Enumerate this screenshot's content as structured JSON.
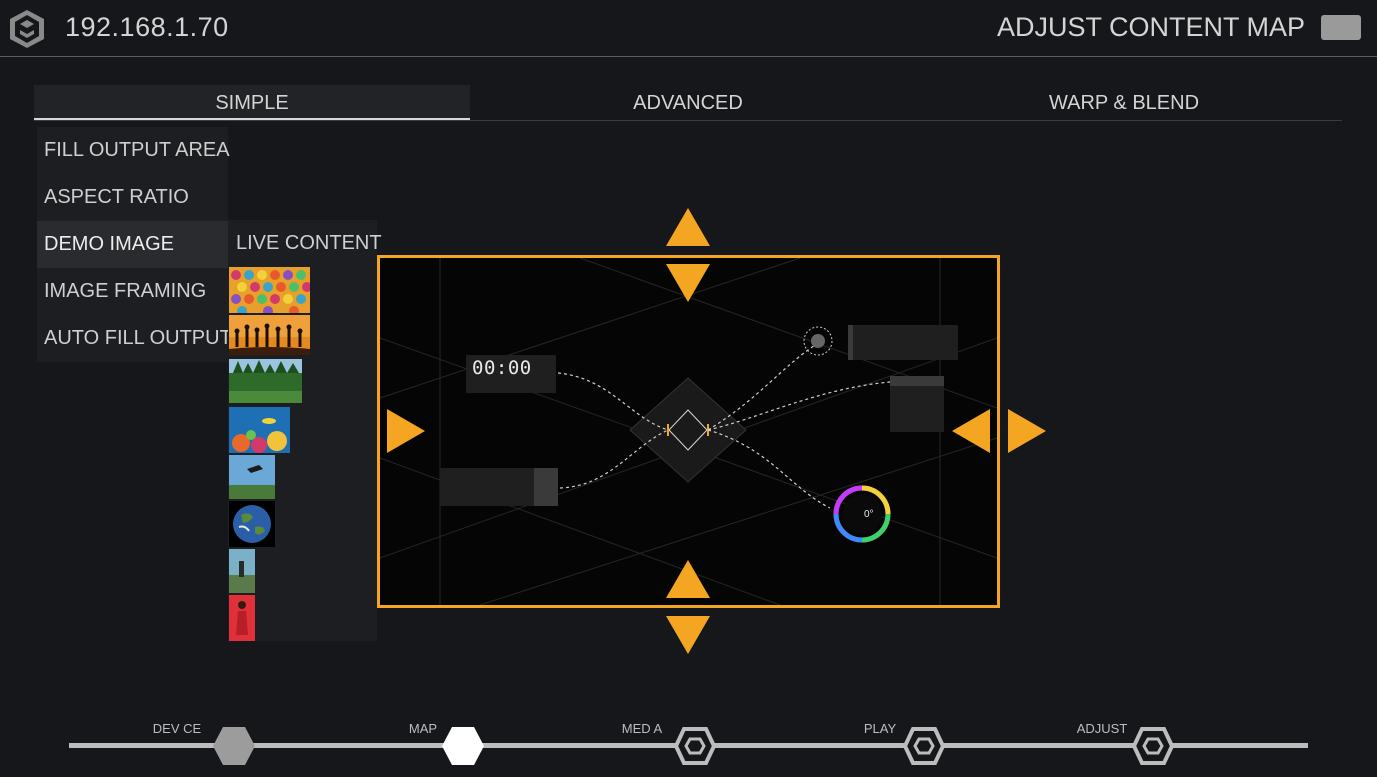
{
  "header": {
    "ip_address": "192.168.1.70",
    "page_title": "ADJUST CONTENT MAP"
  },
  "tabs": [
    {
      "label": "SIMPLE",
      "active": true
    },
    {
      "label": "ADVANCED",
      "active": false
    },
    {
      "label": "WARP & BLEND",
      "active": false
    }
  ],
  "left_menu": [
    {
      "label": "FILL OUTPUT AREA",
      "selected": false
    },
    {
      "label": "ASPECT RATIO",
      "selected": false
    },
    {
      "label": "DEMO IMAGE",
      "selected": true
    },
    {
      "label": "IMAGE FRAMING",
      "selected": false
    },
    {
      "label": "AUTO FILL OUTPUT",
      "selected": false
    }
  ],
  "submenu": {
    "title": "LIVE CONTENT",
    "thumbnails": [
      "colorful-pattern",
      "dancers-silhouette-sunset",
      "forest",
      "coral-reef",
      "skydiver",
      "earth-globe",
      "hiker",
      "red-dress-woman"
    ]
  },
  "preview": {
    "time_display": "00:00",
    "degree_display": "0°"
  },
  "stepper": {
    "steps": [
      {
        "label": "DEV CE",
        "state": "done"
      },
      {
        "label": "MAP",
        "state": "current"
      },
      {
        "label": "MED A",
        "state": "pending"
      },
      {
        "label": "PLAY",
        "state": "pending"
      },
      {
        "label": "ADJUST",
        "state": "pending"
      }
    ]
  },
  "colors": {
    "accent": "#f4a623",
    "background": "#15171a",
    "panel": "#1d1e21",
    "text": "#d4d4d4"
  }
}
